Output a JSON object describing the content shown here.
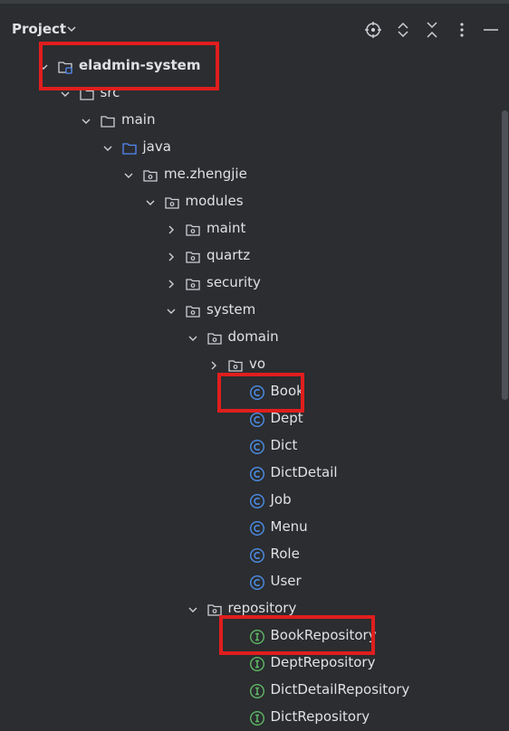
{
  "header": {
    "title": "Project"
  },
  "tree": [
    {
      "label": "eladmin-system",
      "depth": 0,
      "arrow": "down",
      "icon": "module",
      "bold": true
    },
    {
      "label": "src",
      "depth": 1,
      "arrow": "down",
      "icon": "folder"
    },
    {
      "label": "main",
      "depth": 2,
      "arrow": "down",
      "icon": "folder"
    },
    {
      "label": "java",
      "depth": 3,
      "arrow": "down",
      "icon": "source-folder"
    },
    {
      "label": "me.zhengjie",
      "depth": 4,
      "arrow": "down",
      "icon": "package"
    },
    {
      "label": "modules",
      "depth": 5,
      "arrow": "down",
      "icon": "package"
    },
    {
      "label": "maint",
      "depth": 6,
      "arrow": "right",
      "icon": "package"
    },
    {
      "label": "quartz",
      "depth": 6,
      "arrow": "right",
      "icon": "package"
    },
    {
      "label": "security",
      "depth": 6,
      "arrow": "right",
      "icon": "package"
    },
    {
      "label": "system",
      "depth": 6,
      "arrow": "down",
      "icon": "package"
    },
    {
      "label": "domain",
      "depth": 7,
      "arrow": "down",
      "icon": "package"
    },
    {
      "label": "vo",
      "depth": 8,
      "arrow": "right",
      "icon": "package"
    },
    {
      "label": "Book",
      "depth": 9,
      "arrow": "none",
      "icon": "class"
    },
    {
      "label": "Dept",
      "depth": 9,
      "arrow": "none",
      "icon": "class"
    },
    {
      "label": "Dict",
      "depth": 9,
      "arrow": "none",
      "icon": "class"
    },
    {
      "label": "DictDetail",
      "depth": 9,
      "arrow": "none",
      "icon": "class"
    },
    {
      "label": "Job",
      "depth": 9,
      "arrow": "none",
      "icon": "class"
    },
    {
      "label": "Menu",
      "depth": 9,
      "arrow": "none",
      "icon": "class"
    },
    {
      "label": "Role",
      "depth": 9,
      "arrow": "none",
      "icon": "class"
    },
    {
      "label": "User",
      "depth": 9,
      "arrow": "none",
      "icon": "class"
    },
    {
      "label": "repository",
      "depth": 7,
      "arrow": "down",
      "icon": "package"
    },
    {
      "label": "BookRepository",
      "depth": 9,
      "arrow": "none",
      "icon": "interface"
    },
    {
      "label": "DeptRepository",
      "depth": 9,
      "arrow": "none",
      "icon": "interface"
    },
    {
      "label": "DictDetailRepository",
      "depth": 9,
      "arrow": "none",
      "icon": "interface"
    },
    {
      "label": "DictRepository",
      "depth": 9,
      "arrow": "none",
      "icon": "interface"
    }
  ],
  "highlighted": [
    "eladmin-system",
    "Book",
    "BookRepository"
  ],
  "colors": {
    "background": "#2b2d30",
    "text": "#dfe1e5",
    "highlight": "#e01e1e",
    "class_icon": "#4d8fe8",
    "interface_icon": "#5fb865",
    "folder_icon": "#ced0d6",
    "source_folder_icon": "#548af7"
  }
}
